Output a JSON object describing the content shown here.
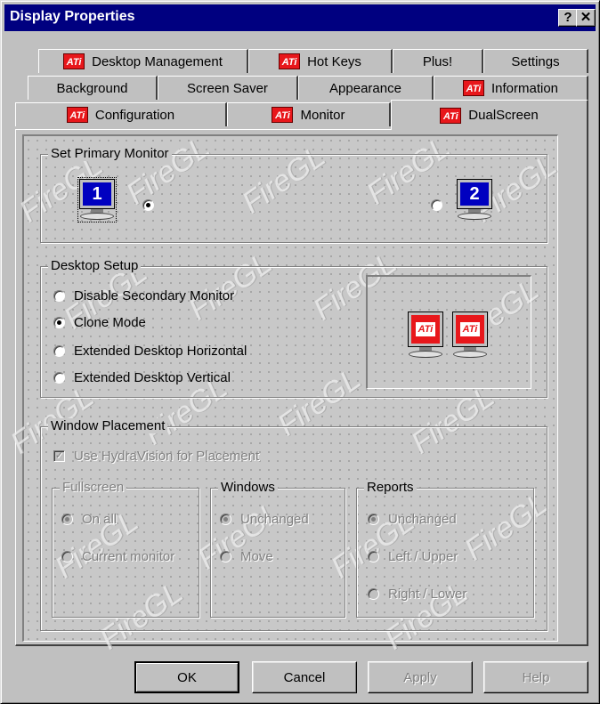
{
  "window": {
    "title": "Display Properties",
    "help_btn": "?",
    "close_btn": "✕"
  },
  "tabs": {
    "row1": [
      "Desktop Management",
      "Hot Keys",
      "Plus!",
      "Settings"
    ],
    "row2": [
      "Background",
      "Screen Saver",
      "Appearance",
      "Information"
    ],
    "row3": [
      "Configuration",
      "Monitor",
      "DualScreen"
    ],
    "active": "DualScreen"
  },
  "ati_logo_text": "ATi",
  "watermark_text": "FireGL",
  "primary": {
    "legend": "Set Primary Monitor",
    "monitor1": "1",
    "monitor2": "2",
    "selected": "1"
  },
  "desktop_setup": {
    "legend": "Desktop Setup",
    "options": [
      "Disable Secondary Monitor",
      "Clone Mode",
      "Extended Desktop Horizontal",
      "Extended Desktop Vertical"
    ],
    "selected": "Clone Mode"
  },
  "placement": {
    "legend": "Window Placement",
    "hydravision_label": "Use HydraVision for Placement",
    "hydravision_checked": true,
    "fullscreen": {
      "legend": "Fullscreen",
      "opt1": "On all",
      "opt2": "Current monitor"
    },
    "windows": {
      "legend": "Windows",
      "opt1": "Unchanged",
      "opt2": "Move"
    },
    "reports": {
      "legend": "Reports",
      "opt1": "Unchanged",
      "opt2": "Left / Upper",
      "opt3": "Right  / Lower"
    }
  },
  "buttons": {
    "ok": "OK",
    "cancel": "Cancel",
    "apply": "Apply",
    "help": "Help"
  }
}
